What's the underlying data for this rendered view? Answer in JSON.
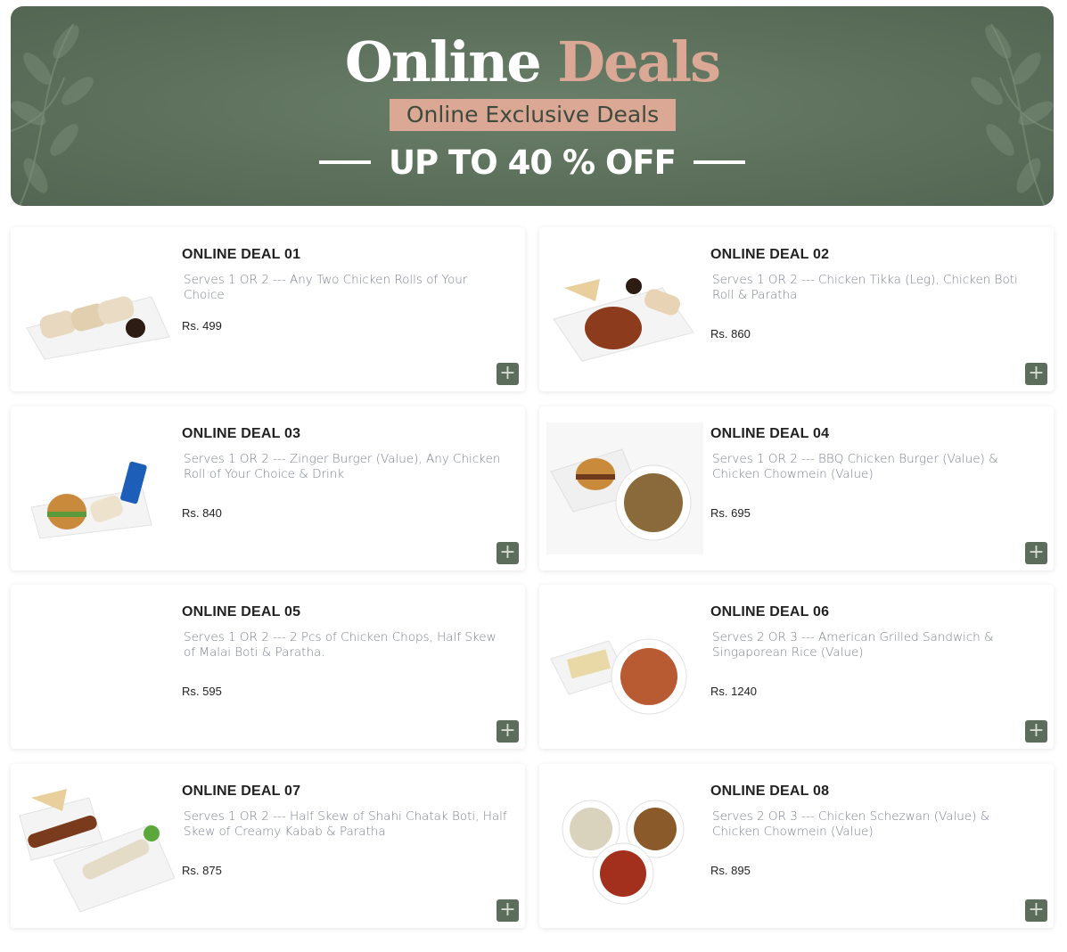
{
  "banner": {
    "title_part1": "Online",
    "title_part2": "Deals",
    "subtitle": "Online Exclusive Deals",
    "offer": "UP TO 40 % OFF",
    "colors": {
      "background": "#5f735f",
      "accent": "#dba896"
    }
  },
  "deals": [
    {
      "title": "ONLINE DEAL 01",
      "description": "Serves 1 OR 2 --- Any Two Chicken Rolls of Your Choice",
      "price": "Rs. 499",
      "image": "chicken-rolls-image"
    },
    {
      "title": "ONLINE DEAL 02",
      "description": "Serves 1 OR 2 --- Chicken Tikka (Leg), Chicken Boti Roll & Paratha",
      "price": "Rs. 860",
      "image": "chicken-tikka-platter-image"
    },
    {
      "title": "ONLINE DEAL 03",
      "description": "Serves 1 OR 2 --- Zinger Burger (Value), Any Chicken Roll of Your Choice & Drink",
      "price": "Rs. 840",
      "image": "burger-roll-drink-image"
    },
    {
      "title": "ONLINE DEAL 04",
      "description": "Serves 1 OR 2 --- BBQ Chicken Burger (Value) & Chicken Chowmein (Value)",
      "price": "Rs. 695",
      "image": "burger-chowmein-image"
    },
    {
      "title": "ONLINE DEAL 05",
      "description": "Serves 1 OR 2 --- 2 Pcs of Chicken Chops, Half Skew of Malai Boti & Paratha.",
      "price": "Rs. 595",
      "image": ""
    },
    {
      "title": "ONLINE DEAL 06",
      "description": "Serves 2 OR 3 --- American Grilled Sandwich & Singaporean Rice (Value)",
      "price": "Rs. 1240",
      "image": "sandwich-rice-image"
    },
    {
      "title": "ONLINE DEAL 07",
      "description": "Serves 1 OR 2 --- Half Skew of Shahi Chatak Boti, Half Skew of Creamy Kabab & Paratha",
      "price": "Rs. 875",
      "image": "kabab-platter-image"
    },
    {
      "title": "ONLINE DEAL 08",
      "description": "Serves 2 OR 3 --- Chicken Schezwan (Value) & Chicken Chowmein (Value)",
      "price": "Rs. 895",
      "image": "three-dishes-image"
    }
  ],
  "add_button_icon": "plus-icon"
}
